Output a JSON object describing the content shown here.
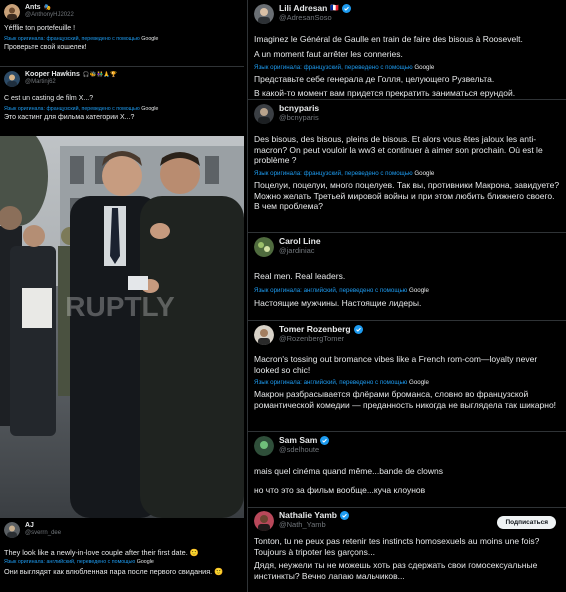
{
  "left": {
    "t1": {
      "name": "Ants",
      "emoji": "🎭",
      "handle": "@AnthonyHJ2022",
      "text": "Yéfflie ton portefeuille !",
      "translation": "Язык оригинала: французский, переведено с помощью",
      "google": "Google",
      "translated": "Проверьте свой кошелек!"
    },
    "t2": {
      "name": "Kooper Hawkins",
      "emoji": "🎧🐝👫🙏🏆",
      "handle": "@Martinj62",
      "text": "C est un casting de film X...?",
      "translation": "Язык оригинала: французский, переведено с помощью",
      "google": "Google",
      "translated": "Это кастинг для фильма категории X...?"
    },
    "photo": {
      "watermark": "RUPTLY"
    },
    "t3": {
      "name": "AJ",
      "handle": "@sverrn_dee",
      "text": "They look like a newly-in-love couple after their first date.",
      "emoji": "🙂",
      "translation": "Язык оригинала: английский, переведено с помощью",
      "google": "Google",
      "translated": "Они выглядят как влюбленная пара после первого свидания.",
      "emoji2": "🙂"
    }
  },
  "right": {
    "t1": {
      "name": "Lili Adresan",
      "emoji": "🇫🇷",
      "handle": "@AdresanSoso",
      "text1": "Imaginez le Général de Gaulle en train de faire des bisous à Roosevelt.",
      "text2": "A un moment faut arrêter les conneries.",
      "translation": "Язык оригинала: французский, переведено с помощью",
      "google": "Google",
      "translated1": "Представьте себе генерала де Голля, целующего Рузвельта.",
      "translated2": "В какой-то момент вам придется прекратить заниматься ерундой."
    },
    "t2": {
      "name": "bcnyparis",
      "handle": "@bcnyparis",
      "text": "Des bisous, des bisous, pleins de bisous. Et alors vous êtes jaloux les anti-macron? On peut vouloir la ww3 et continuer à aimer son prochain. Où est le problème ?",
      "translation": "Язык оригинала: французский, переведено с помощью",
      "google": "Google",
      "translated": "Поцелуи, поцелуи, много поцелуев. Так вы, противники Макрона, завидуете? Можно желать Третьей мировой войны и при этом любить ближнего своего. В чем проблема?"
    },
    "t3": {
      "name": "Carol Line",
      "handle": "@jardiniac",
      "text": "Real men. Real leaders.",
      "translation": "Язык оригинала: английский, переведено с помощью",
      "google": "Google",
      "translated": "Настоящие мужчины. Настоящие лидеры."
    },
    "t4": {
      "name": "Tomer Rozenberg",
      "handle": "@RozenbergTomer",
      "text": "Macron's tossing out bromance vibes like a French rom-com—loyalty never looked so chic!",
      "translation": "Язык оригинала: английский, переведено с помощью",
      "google": "Google",
      "translated": "Макрон разбрасывается флёрами броманса, словно во французской романтической комедии — преданность никогда не выглядела так шикарно!"
    },
    "t5": {
      "name": "Sam Sam",
      "handle": "@sdelhoute",
      "text": "mais quel cinéma quand même...bande de clowns",
      "translated": "но что это за фильм вообще...куча клоунов"
    },
    "t6": {
      "name": "Nathalie Yamb",
      "handle": "@Nath_Yamb",
      "follow": "Подписаться",
      "text": "Tonton, tu ne peux pas retenir tes instincts homosexuels au moins une fois? Toujours à tripoter les garçons...",
      "translated": "Дядя, неужели ты не можешь хоть раз сдержать свои гомосексуальные инстинкты? Вечно лапаю мальчиков..."
    }
  },
  "colors": {
    "bg": "#000000",
    "text": "#e7e9ea",
    "muted": "#71767b",
    "link": "#1d9bf0",
    "verified": "#1d9bf0",
    "border": "#2f3336"
  }
}
